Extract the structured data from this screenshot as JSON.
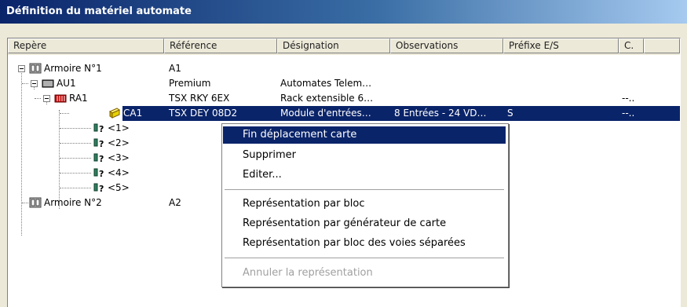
{
  "window": {
    "title": "Définition du matériel automate"
  },
  "columns": [
    "Repère",
    "Référence",
    "Désignation",
    "Observations",
    "Préfixe E/S",
    "C."
  ],
  "rows": [
    {
      "repere": "Armoire N°1",
      "reference": "A1",
      "designation": "",
      "observations": "",
      "prefix": "",
      "c": ""
    },
    {
      "repere": "AU1",
      "reference": "Premium",
      "designation": "Automates Telem…",
      "observations": "",
      "prefix": "",
      "c": ""
    },
    {
      "repere": "RA1",
      "reference": "TSX RKY 6EX",
      "designation": "Rack extensible 6…",
      "observations": "",
      "prefix": "",
      "c": "--.."
    },
    {
      "repere": "CA1",
      "reference": "TSX DEY 08D2",
      "designation": "Module d'entrées…",
      "observations": "8 Entrées - 24 VD…",
      "prefix": "S",
      "c": "--.."
    },
    {
      "repere": "<1>",
      "reference": "",
      "designation": "",
      "observations": "",
      "prefix": "",
      "c": ""
    },
    {
      "repere": "<2>",
      "reference": "",
      "designation": "",
      "observations": "",
      "prefix": "",
      "c": ""
    },
    {
      "repere": "<3>",
      "reference": "",
      "designation": "",
      "observations": "",
      "prefix": "",
      "c": ""
    },
    {
      "repere": "<4>",
      "reference": "",
      "designation": "",
      "observations": "",
      "prefix": "",
      "c": ""
    },
    {
      "repere": "<5>",
      "reference": "",
      "designation": "",
      "observations": "",
      "prefix": "",
      "c": ""
    },
    {
      "repere": "Armoire N°2",
      "reference": "A2",
      "designation": "",
      "observations": "",
      "prefix": "",
      "c": ""
    }
  ],
  "context_menu": {
    "items": [
      {
        "label": "Fin déplacement carte",
        "state": "highlighted"
      },
      {
        "label": "Supprimer",
        "state": "enabled"
      },
      {
        "label": "Editer...",
        "state": "enabled"
      },
      {
        "label": "Représentation par bloc",
        "state": "enabled"
      },
      {
        "label": "Représentation par générateur de carte",
        "state": "enabled"
      },
      {
        "label": "Représentation par bloc des voies séparées",
        "state": "enabled"
      },
      {
        "label": "Annuler la représentation",
        "state": "disabled"
      }
    ]
  },
  "icons": [
    "cabinet-icon",
    "plc-icon",
    "rack-icon",
    "module-icon",
    "empty-slot-icon"
  ],
  "colors": {
    "selection": "#0a246a",
    "rack": "#c00000",
    "module": "#e6d200"
  }
}
